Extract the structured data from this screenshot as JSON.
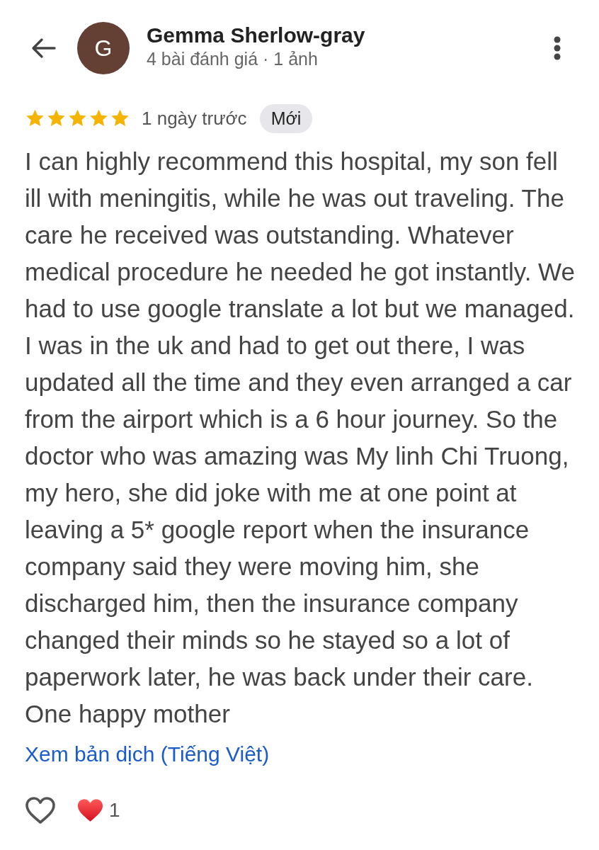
{
  "header": {
    "avatar_initial": "G",
    "name": "Gemma Sherlow-gray",
    "meta": "4 bài đánh giá · 1 ảnh"
  },
  "review": {
    "stars": 5,
    "time": "1 ngày trước",
    "badge": "Mới",
    "text": "I can highly recommend this hospital, my son fell ill with meningitis, while he was out traveling. The care he received was outstanding. Whatever medical procedure he needed he got instantly. We had to use google translate a lot but we managed. I was in the uk and had to get out there, I was updated all the time and they even arranged a car from the airport which is a 6 hour journey. So the doctor who was amazing was My linh Chi Truong, my hero, she did joke with me at one point at leaving a 5* google report when the insurance company said they were moving him, she discharged him, then the insurance company changed their minds so he stayed so a lot of paperwork later, he was back under their care. One happy mother",
    "translate_link": "Xem bản dịch (Tiếng Việt)"
  },
  "reactions": {
    "liked": false,
    "count": "1"
  }
}
